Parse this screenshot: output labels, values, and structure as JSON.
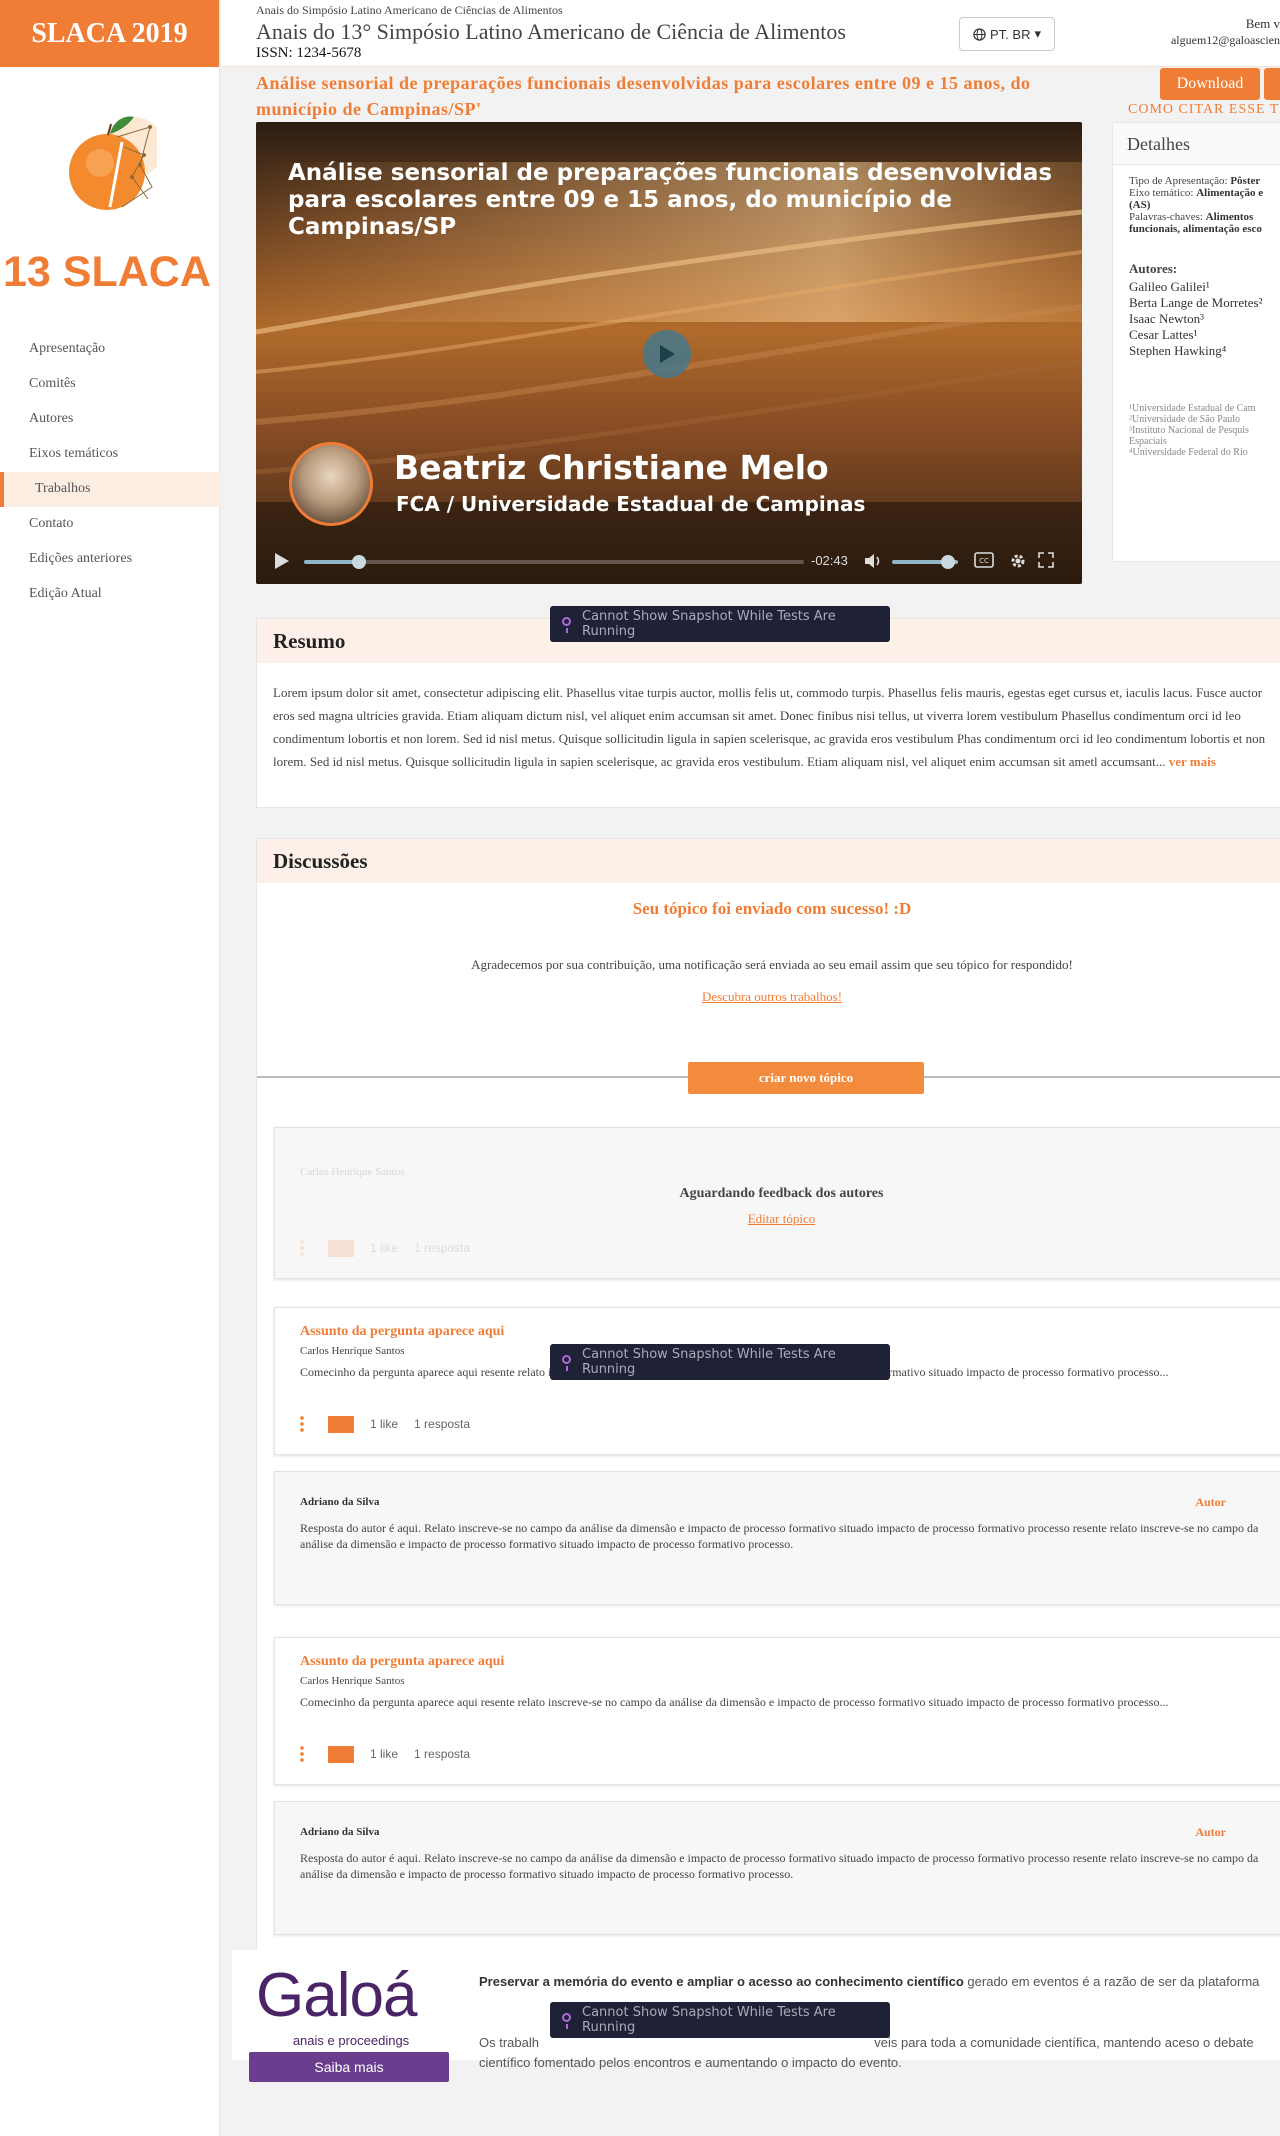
{
  "sidebar": {
    "brand": "SLACA 2019",
    "logo_text": "13 SLACA",
    "nav": [
      {
        "label": "Apresentação",
        "active": false
      },
      {
        "label": "Comitês",
        "active": false
      },
      {
        "label": "Autores",
        "active": false
      },
      {
        "label": "Eixos temáticos",
        "active": false
      },
      {
        "label": "Trabalhos",
        "active": true
      },
      {
        "label": "Contato",
        "active": false
      },
      {
        "label": "Edições anteriores",
        "active": false
      },
      {
        "label": "Edição Atual",
        "active": false
      }
    ]
  },
  "header": {
    "kicker": "Anais do Simpósio Latino Americano de Ciências de Alimentos",
    "title": "Anais do 13° Simpósio Latino Americano de Ciência de Alimentos",
    "issn": "ISSN: 1234-5678",
    "language": "PT. BR",
    "greeting": "Bem v",
    "email": "alguem12@galoascien"
  },
  "work": {
    "title": "Análise sensorial de preparações funcionais desenvolvidas para escolares entre 09 e 15 anos, do município de Campinas/SP'",
    "download_label": "Download",
    "cite_label": "COMO CITAR ESSE TR"
  },
  "video": {
    "title": "Análise sensorial de preparações funcionais desenvolvidas para escolares entre 09 e 15 anos, do município de Campinas/SP",
    "speaker": "Beatriz Christiane Melo",
    "institution": "FCA / Universidade Estadual de Campinas",
    "time_remaining": "-02:43",
    "progress": 0.11,
    "volume": 0.85
  },
  "details": {
    "heading": "Detalhes",
    "type_label": "Tipo de Apresentação:",
    "type_value": "Pôster",
    "axis_label": "Eixo temático:",
    "axis_value": "Alimentação e",
    "axis_suffix": "(AS)",
    "keywords_label": "Palavras-chaves:",
    "keywords_value": "Alimentos funcionais, alimentação esco",
    "authors_heading": "Autores:",
    "authors": [
      "Galileo Galilei¹",
      "Berta Lange de Morretes²",
      "Isaac Newton³",
      "Cesar Lattes¹",
      "Stephen Hawking⁴"
    ],
    "affiliations": [
      "¹Universidade Estadual de Cam",
      "²Universidade de São Paulo",
      "³Instituto Nacional de Pesquis",
      "Espaciais",
      "⁴Universidade Federal do Rio"
    ]
  },
  "tooltip_text": "Cannot Show Snapshot While Tests Are Running",
  "resumo": {
    "heading": "Resumo",
    "text": "Lorem ipsum dolor sit amet, consectetur adipiscing elit. Phasellus vitae turpis auctor, mollis felis ut, commodo turpis. Phasellus felis mauris, egestas eget cursus et, iaculis lacus. Fusce auctor eros sed magna ultricies gravida. Etiam aliquam dictum nisl, vel aliquet enim accumsan sit amet. Donec finibus nisi tellus, ut viverra lorem vestibulum Phasellus condimentum orci id leo condimentum lobortis et non lorem. Sed id nisl metus. Quisque sollicitudin ligula in sapien scelerisque, ac gravida eros vestibulum Phas condimentum orci id leo condimentum lobortis et non lorem. Sed id nisl metus. Quisque sollicitudin ligula in sapien scelerisque, ac gravida eros vestibulum. Etiam aliquam nisl, vel aliquet enim accumsan sit ametl accumsant...",
    "more": "ver mais"
  },
  "discussions": {
    "heading": "Discussões",
    "success": "Seu tópico foi enviado com sucesso! :D",
    "thanks": "Agradecemos por sua contribuição, uma notificação será enviada ao seu email assim que seu tópico for respondido!",
    "discover": "Descubra outros trabalhos!",
    "new_topic": "criar novo tópico",
    "pending": {
      "author": "Carlos Henrique Santos",
      "message": "Aguardando feedback dos autores",
      "edit": "Editar tópico",
      "likes": "1 like",
      "replies": "1 resposta"
    },
    "topics": [
      {
        "subject": "Assunto da pergunta aparece aqui",
        "author": "Carlos Henrique Santos",
        "body": "Comecinho da pergunta aparece aqui resente relato inscreve-se no campo da análise da dimensão e impacto de processo formativo situado impacto de processo formativo processo...",
        "likes": "1 like",
        "replies": "1 resposta",
        "reply": {
          "author": "Adriano da Silva",
          "tag": "Autor",
          "body": "Resposta do autor é aqui. Relato inscreve-se no campo da análise da dimensão e impacto de processo formativo situado impacto de processo formativo processo resente relato inscreve-se no campo da análise da dimensão e impacto de processo formativo situado impacto de processo formativo processo."
        }
      },
      {
        "subject": "Assunto da pergunta aparece aqui",
        "author": "Carlos Henrique Santos",
        "body": "Comecinho da pergunta aparece aqui resente relato inscreve-se no campo da análise da dimensão e impacto de processo formativo situado impacto de processo formativo processo...",
        "likes": "1 like",
        "replies": "1 resposta",
        "reply": {
          "author": "Adriano da Silva",
          "tag": "Autor",
          "body": "Resposta do autor é aqui. Relato inscreve-se no campo da análise da dimensão e impacto de processo formativo situado impacto de processo formativo processo resente relato inscreve-se no campo da análise da dimensão e impacto de processo formativo situado impacto de processo formativo processo."
        }
      }
    ]
  },
  "footer": {
    "logo": "Galoá",
    "logo_sub": "anais e proceedings",
    "button": "Saiba mais",
    "lead_bold": "Preservar a memória do evento e ampliar o acesso ao conhecimento científico",
    "lead_rest": "gerado em eventos é a razão de ser da plataforma",
    "line2_start": "Os trabalh",
    "line2_end": "veis para toda a comunidade científica, mantendo aceso o debate científico fomentado pelos encontros e aumentando o impacto do evento."
  },
  "colors": {
    "accent": "#f07d35",
    "galoa_purple": "#4b2468",
    "tooltip_bg": "#1f2236"
  }
}
